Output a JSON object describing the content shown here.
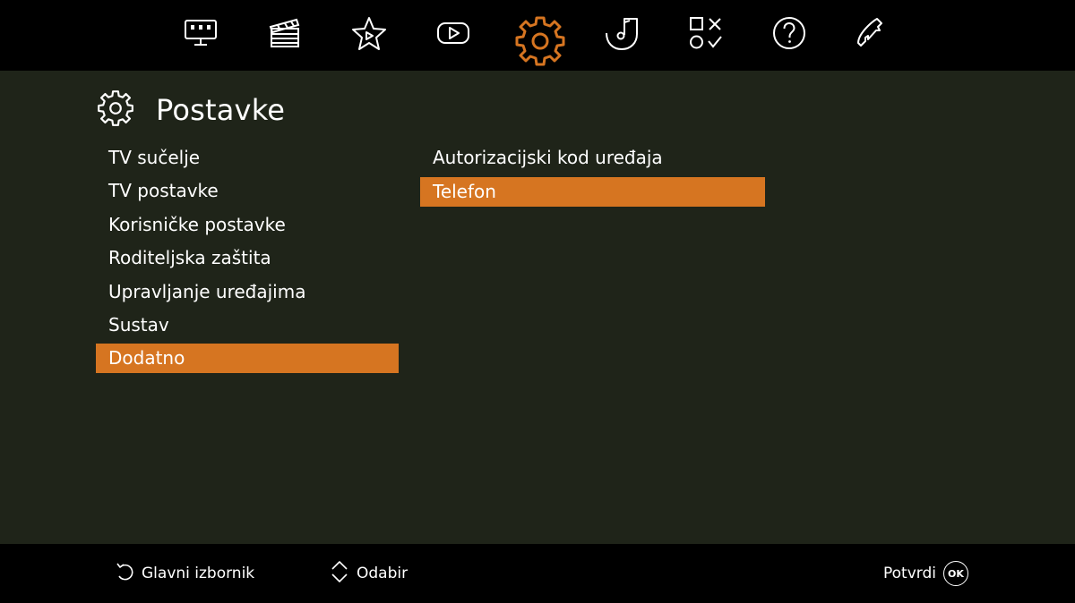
{
  "nav": {
    "accent_color": "#d67521",
    "icons": [
      {
        "icon": "tv-guide-icon",
        "active": false
      },
      {
        "icon": "clapperboard-icon",
        "active": false
      },
      {
        "icon": "star-play-icon",
        "active": false
      },
      {
        "icon": "youtube-play-icon",
        "active": false
      },
      {
        "icon": "gear-icon",
        "active": true
      },
      {
        "icon": "music-note-icon",
        "active": false
      },
      {
        "icon": "games-icon",
        "active": false
      },
      {
        "icon": "help-icon",
        "active": false
      },
      {
        "icon": "phone-icon",
        "active": false
      }
    ]
  },
  "header": {
    "icon": "gear-icon",
    "title": "Postavke"
  },
  "left_menu": {
    "items": [
      {
        "label": "TV sučelje"
      },
      {
        "label": "TV postavke"
      },
      {
        "label": "Korisničke postavke"
      },
      {
        "label": "Roditeljska zaštita"
      },
      {
        "label": "Upravljanje uređajima"
      },
      {
        "label": "Sustav"
      },
      {
        "label": "Dodatno",
        "selected": true
      }
    ]
  },
  "right_menu": {
    "items": [
      {
        "label": "Autorizacijski kod uređaja"
      },
      {
        "label": "Telefon",
        "selected": true
      }
    ]
  },
  "footer": {
    "back_label": "Glavni izbornik",
    "select_label": "Odabir",
    "confirm_label": "Potvrdi",
    "ok_label": "OK"
  }
}
